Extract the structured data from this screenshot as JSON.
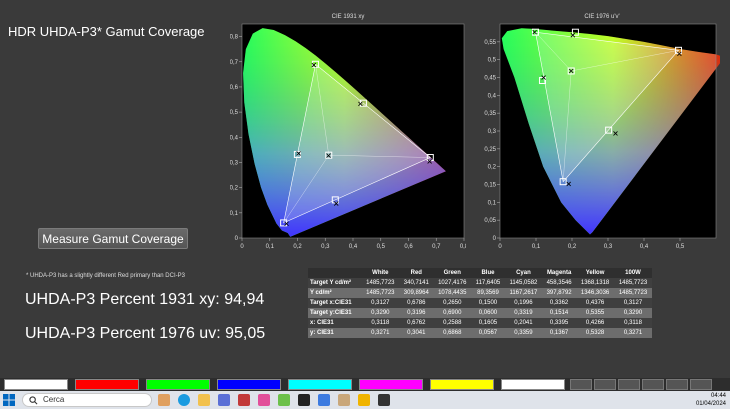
{
  "title": "HDR UHDA-P3* Gamut Coverage",
  "measure_button": "Measure Gamut Coverage",
  "footnote": "* UHDA-P3 has a slightly different Red primary than DCI-P3",
  "percent_1931": "UHDA-P3 Percent 1931 xy: 94,94",
  "percent_1976": "UHDA-P3 Percent 1976 uv: 95,05",
  "table": {
    "headers": [
      "",
      "White",
      "Red",
      "Green",
      "Blue",
      "Cyan",
      "Magenta",
      "Yellow",
      "100W"
    ],
    "rows": [
      [
        "Target Y cd/m²",
        "1485,7723",
        "340,7141",
        "1027,4176",
        "117,6405",
        "1145,0582",
        "458,3546",
        "1368,1318",
        "1485,7723"
      ],
      [
        "Y cd/m²",
        "1485,7723",
        "309,8964",
        "1078,4435",
        "89,3569",
        "1167,2617",
        "397,8792",
        "1346,3036",
        "1485,7723"
      ],
      [
        "Target x:CIE31",
        "0,3127",
        "0,6786",
        "0,2650",
        "0,1500",
        "0,1996",
        "0,3362",
        "0,4376",
        "0,3127"
      ],
      [
        "Target y:CIE31",
        "0,3290",
        "0,3196",
        "0,6900",
        "0,0600",
        "0,3319",
        "0,1514",
        "0,5355",
        "0,3290"
      ],
      [
        "x: CIE31",
        "0,3118",
        "0,6762",
        "0,2588",
        "0,1605",
        "0,2041",
        "0,3395",
        "0,4266",
        "0,3118"
      ],
      [
        "y: CIE31",
        "0,3271",
        "0,3041",
        "0,6868",
        "0,0567",
        "0,3359",
        "0,1367",
        "0,5328",
        "0,3271"
      ]
    ]
  },
  "chart_data": [
    {
      "type": "scatter",
      "title": "CIE 1931 xy",
      "xlim": [
        0,
        0.8
      ],
      "ylim": [
        0,
        0.85
      ],
      "x_ticks": [
        "0",
        "0,1",
        "0,2",
        "0,3",
        "0,4",
        "0,5",
        "0,6",
        "0,7",
        "0,8"
      ],
      "y_ticks": [
        "0",
        "0,1",
        "0,2",
        "0,3",
        "0,4",
        "0,5",
        "0,6",
        "0,7",
        "0,8"
      ],
      "series": [
        {
          "x": [
            0.3127,
            0.6786,
            0.265,
            0.15,
            0.1996,
            0.3362,
            0.4376
          ],
          "y": [
            0.329,
            0.3196,
            0.69,
            0.06,
            0.3319,
            0.1514,
            0.5355
          ]
        },
        {
          "x": [
            0.3118,
            0.6762,
            0.2588,
            0.1605,
            0.2041,
            0.3395,
            0.4266
          ],
          "y": [
            0.3271,
            0.3041,
            0.6868,
            0.0567,
            0.3359,
            0.1367,
            0.5328
          ]
        }
      ]
    },
    {
      "type": "scatter",
      "title": "CIE 1976 u'v'",
      "xlim": [
        0,
        0.6
      ],
      "ylim": [
        0,
        0.6
      ],
      "x_ticks": [
        "0",
        "0,1",
        "0,2",
        "0,3",
        "0,4",
        "0,5"
      ],
      "y_ticks": [
        "0",
        "0,05",
        "0,1",
        "0,15",
        "0,2",
        "0,25",
        "0,3",
        "0,35",
        "0,4",
        "0,45",
        "0,5",
        "0,55"
      ],
      "series": [
        {
          "x": [
            0.1978,
            0.4958,
            0.0986,
            0.1754,
            0.118,
            0.3018,
            0.2095
          ],
          "y": [
            0.4683,
            0.5262,
            0.5771,
            0.1579,
            0.4416,
            0.3024,
            0.577
          ]
        },
        {
          "x": [
            0.1978,
            0.4983,
            0.0962,
            0.1908,
            0.1212,
            0.3208,
            0.2023
          ],
          "y": [
            0.4682,
            0.5162,
            0.5773,
            0.1516,
            0.4499,
            0.2932,
            0.5686
          ]
        }
      ]
    }
  ],
  "swatch_colors": [
    "#ffffff",
    "#ff0000",
    "#00ff00",
    "#0000ff",
    "#00ffff",
    "#ff00ff",
    "#ffff00",
    "#ffffff"
  ],
  "taskbar": {
    "search_placeholder": "Cerca",
    "time": "04:44",
    "date": "01/04/2024"
  }
}
